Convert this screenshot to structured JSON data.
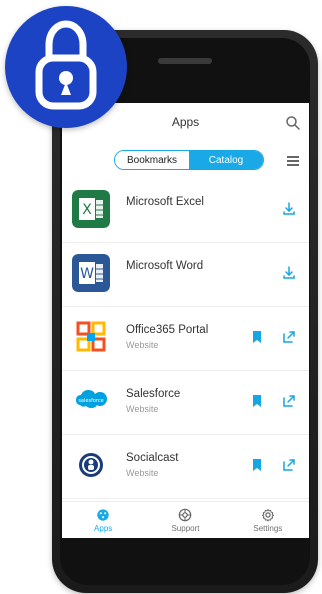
{
  "colors": {
    "accent": "#18a9e6",
    "lock_badge": "#1d43c5",
    "phone": "#1b1b1b"
  },
  "header": {
    "title": "Apps"
  },
  "segmented": {
    "bookmarks": "Bookmarks",
    "catalog": "Catalog",
    "active": "Catalog"
  },
  "apps": [
    {
      "name": "Microsoft Excel",
      "subtitle": "",
      "icon": "excel-icon",
      "actions": [
        "download-icon"
      ]
    },
    {
      "name": "Microsoft Word",
      "subtitle": "",
      "icon": "word-icon",
      "actions": [
        "download-icon"
      ]
    },
    {
      "name": "Office365 Portal",
      "subtitle": "Website",
      "icon": "office365-icon",
      "actions": [
        "bookmark-icon",
        "open-external-icon"
      ]
    },
    {
      "name": "Salesforce",
      "subtitle": "Website",
      "icon": "salesforce-icon",
      "actions": [
        "bookmark-icon",
        "open-external-icon"
      ]
    },
    {
      "name": "Socialcast",
      "subtitle": "Website",
      "icon": "socialcast-icon",
      "actions": [
        "bookmark-icon",
        "open-external-icon"
      ]
    }
  ],
  "bottom_nav": [
    {
      "label": "Apps",
      "icon": "apps-icon",
      "active": true
    },
    {
      "label": "Support",
      "icon": "support-icon",
      "active": false
    },
    {
      "label": "Settings",
      "icon": "settings-icon",
      "active": false
    }
  ],
  "salesforce_logo_text": "salesforce"
}
